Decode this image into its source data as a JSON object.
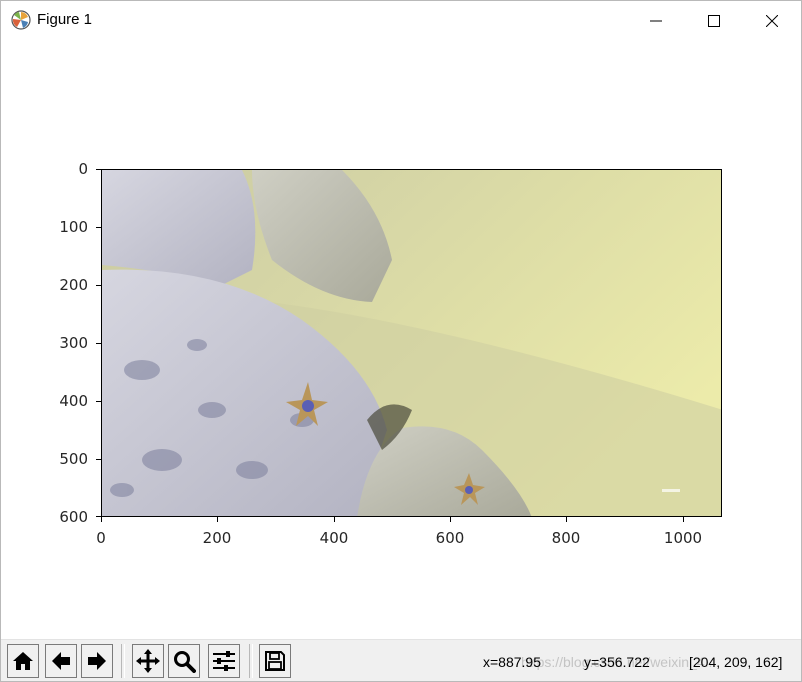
{
  "window": {
    "title": "Figure 1",
    "icon": "matplotlib-icon",
    "controls": [
      "minimize-icon",
      "maximize-icon",
      "close-icon"
    ]
  },
  "plot": {
    "image_description_colors": {
      "water": "#dcdca8",
      "rock": "#c8c8d4",
      "seabed": "#b4b496"
    },
    "y_ticks": [
      "0",
      "100",
      "200",
      "300",
      "400",
      "500",
      "600"
    ],
    "x_ticks": [
      "0",
      "200",
      "400",
      "600",
      "800",
      "1000"
    ]
  },
  "toolbar": {
    "buttons": [
      {
        "name": "home-icon"
      },
      {
        "name": "back-arrow-icon"
      },
      {
        "name": "forward-arrow-icon"
      },
      {
        "name": "pan-icon"
      },
      {
        "name": "zoom-icon"
      },
      {
        "name": "configure-subplots-icon"
      },
      {
        "name": "save-icon"
      }
    ],
    "x_readout": "x=887.95",
    "y_readout": "y=356.722",
    "pixel_value": "[204, 209, 162]",
    "watermark": "https://blog.csdn.net/weixin_4..."
  }
}
